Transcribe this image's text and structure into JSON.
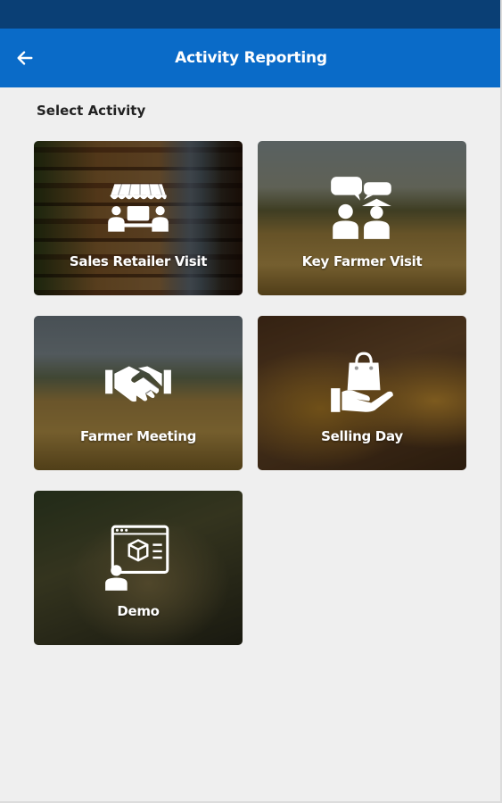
{
  "app_bar": {
    "title": "Activity Reporting",
    "back_icon": "arrow-left-icon",
    "color": "#0a6bc8",
    "status_bar_color": "#0a3f75"
  },
  "section": {
    "label": "Select Activity"
  },
  "activities": [
    {
      "label": "Sales Retailer Visit",
      "icon": "store-people-icon"
    },
    {
      "label": "Key Farmer Visit",
      "icon": "farmers-chat-icon"
    },
    {
      "label": "Farmer Meeting",
      "icon": "handshake-icon"
    },
    {
      "label": "Selling Day",
      "icon": "hand-shopping-bag-icon"
    },
    {
      "label": "Demo",
      "icon": "presentation-box-icon"
    }
  ]
}
